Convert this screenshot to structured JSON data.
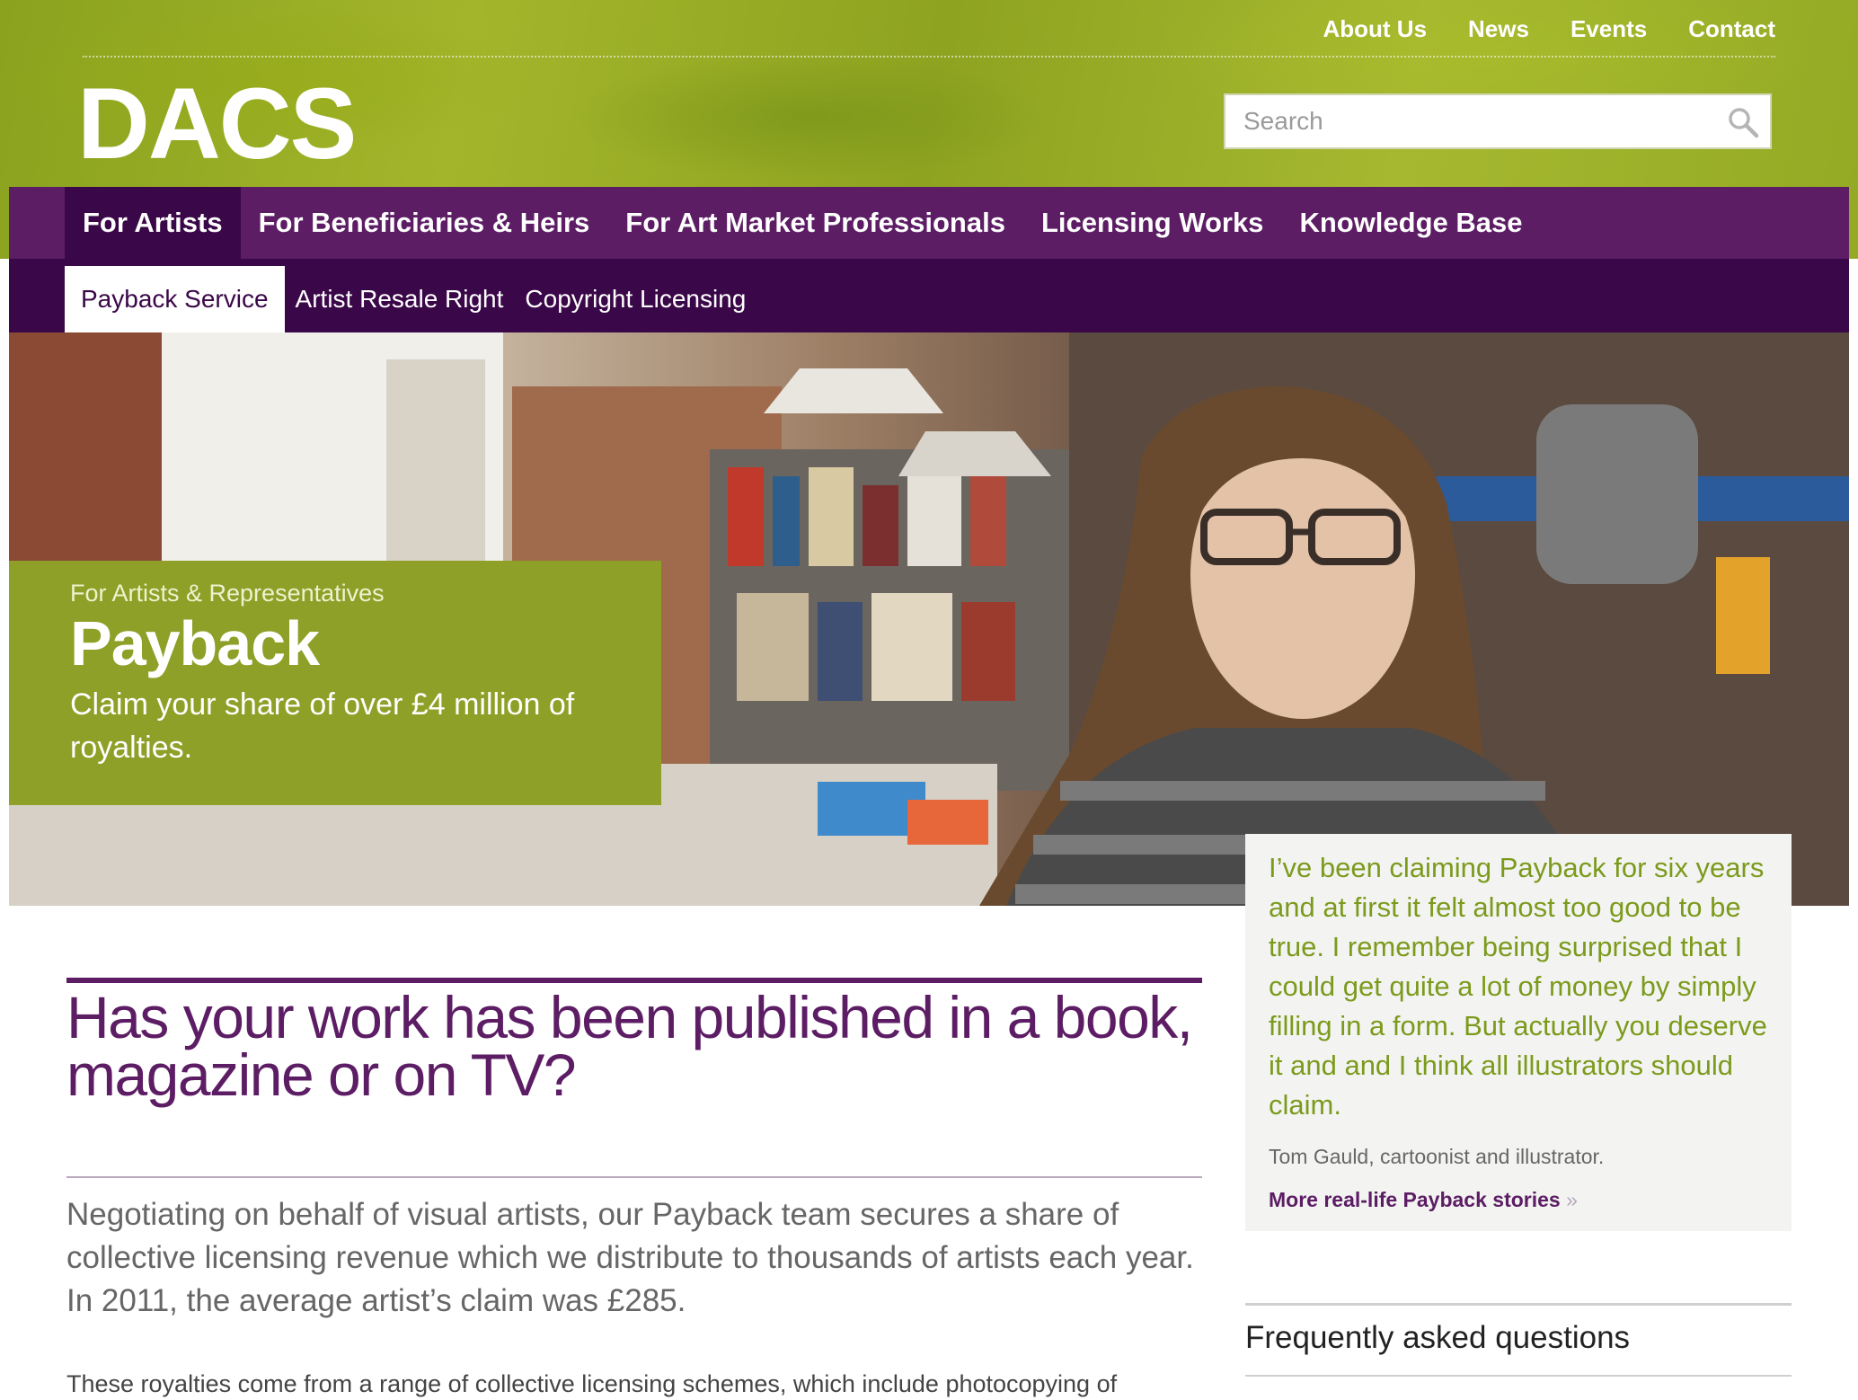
{
  "header": {
    "utility_nav": [
      "About Us",
      "News",
      "Events",
      "Contact"
    ],
    "logo_text": "DACS",
    "search": {
      "placeholder": "Search",
      "value": ""
    }
  },
  "primary_nav": {
    "items": [
      "For Artists",
      "For Beneficiaries & Heirs",
      "For Art Market Professionals",
      "Licensing Works",
      "Knowledge Base"
    ],
    "active": "For Artists"
  },
  "secondary_nav": {
    "items": [
      "Payback Service",
      "Artist Resale Right",
      "Copyright Licensing"
    ],
    "active": "Payback Service"
  },
  "hero": {
    "eyebrow": "For Artists & Representatives",
    "title": "Payback",
    "subtitle": "Claim your share of over £4 million of royalties."
  },
  "quote": {
    "text": "I’ve been claiming Payback for six years and at first it felt almost too good to be true. I remember being surprised that I could get quite a lot of money by simply filling in a form. But actually you deserve it and and I think all illustrators should claim.",
    "attribution": "Tom Gauld, cartoonist and illustrator.",
    "link_label": "More real-life Payback stories",
    "link_chevron": "»"
  },
  "main": {
    "heading": "Has your work has been published in a book, magazine or on TV?",
    "intro": "Negotiating on behalf of visual artists, our Payback team secures a share of collective licensing revenue which we distribute to thousands of artists each year. In 2011, the average artist’s claim was £285.",
    "body_partial": "These royalties come from a range of collective licensing schemes, which include photocopying of"
  },
  "faq": {
    "heading": "Frequently asked questions"
  },
  "colors": {
    "brand_purple": "#5c1d64",
    "deep_purple": "#3a0748",
    "brand_green": "#8ea027",
    "quote_green": "#7c9a1c"
  }
}
